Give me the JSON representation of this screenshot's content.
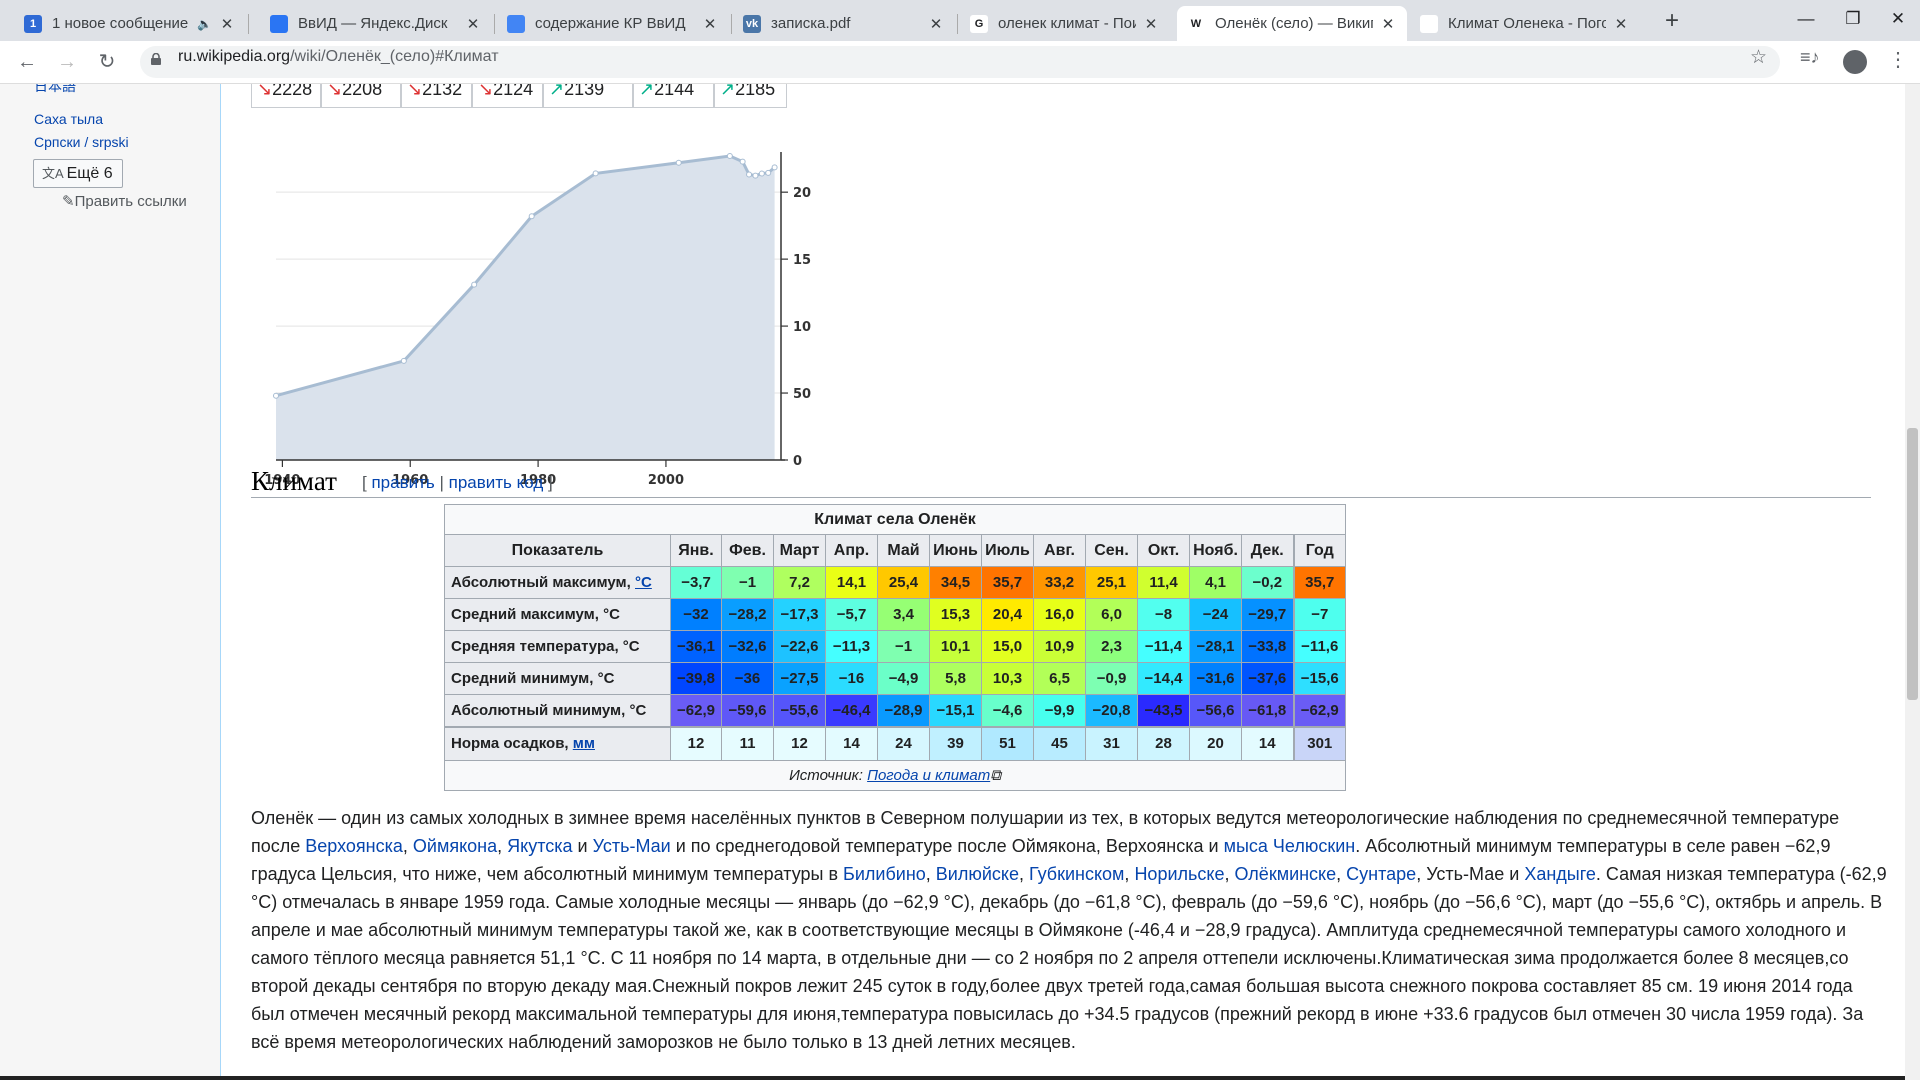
{
  "browser": {
    "tabs": [
      {
        "title": "1 новое сообщение",
        "favicon": "1",
        "fav_color": "#2f6ad5",
        "extra": "audio-icon"
      },
      {
        "title": "ВвИД — Яндекс.Диск",
        "favicon": "",
        "fav_color": "#2a75f3"
      },
      {
        "title": "содержание КР ВвИД",
        "favicon": "",
        "fav_color": "#4285f4"
      },
      {
        "title": "записка.pdf",
        "favicon": "vk",
        "fav_color": "#4a76a8"
      },
      {
        "title": "оленек климат - Поиск",
        "favicon": "G",
        "fav_color": "#ffffff"
      },
      {
        "title": "Оленёк (село) — Википедия",
        "favicon": "W",
        "fav_color": "#ffffff"
      },
      {
        "title": "Климат Оленека - Погода",
        "favicon": "",
        "fav_color": "#ffffff"
      }
    ],
    "new_tab": "+",
    "window_controls": {
      "minimize": "—",
      "maximize": "❐",
      "close": "✕"
    },
    "url_host": "ru.wikipedia.org",
    "url_path": "/wiki/Оленёк_(село)#Климат"
  },
  "sidebar": {
    "langs": [
      "日本語",
      "Саха тыла",
      "Српски / srpski"
    ],
    "more": "Ещё 6",
    "edit_links": "Править ссылки"
  },
  "population": {
    "cells": [
      {
        "arrow": "↘",
        "value": "2228",
        "dir": "down"
      },
      {
        "arrow": "↘",
        "value": "2208",
        "dir": "down"
      },
      {
        "arrow": "↘",
        "value": "2132",
        "dir": "down"
      },
      {
        "arrow": "↘",
        "value": "2124",
        "dir": "down"
      },
      {
        "arrow": "↗",
        "value": "2139",
        "dir": "up"
      },
      {
        "arrow": "↗",
        "value": "2144",
        "dir": "up"
      },
      {
        "arrow": "↗",
        "value": "2185",
        "dir": "up"
      }
    ]
  },
  "chart_data": {
    "type": "area",
    "title": "",
    "xlabel": "",
    "ylabel": "",
    "x": [
      1939,
      1959,
      1970,
      1979,
      1989,
      2002,
      2010,
      2012,
      2013,
      2014,
      2015,
      2016,
      2017
    ],
    "values": [
      480,
      740,
      1310,
      1820,
      2140,
      2220,
      2270,
      2228,
      2132,
      2124,
      2139,
      2144,
      2185
    ],
    "xticks": [
      "1940",
      "1960",
      "1980",
      "2000"
    ],
    "yticks": [
      "0",
      "500",
      "1000",
      "1500",
      "2000"
    ],
    "xlim": [
      1939,
      2018
    ],
    "ylim": [
      0,
      2300
    ],
    "grid": true,
    "colors": {
      "line": "#a7bcd2",
      "fill": "#dae2ec",
      "point": "#ffffff"
    }
  },
  "climate": {
    "heading": "Климат",
    "edit": "править",
    "edit_code": "править код",
    "caption": "Климат села Оленёк",
    "head_label": "Показатель",
    "months": [
      "Янв.",
      "Фев.",
      "Март",
      "Апр.",
      "Май",
      "Июнь",
      "Июль",
      "Авг.",
      "Сен.",
      "Окт.",
      "Нояб.",
      "Дек."
    ],
    "year": "Год",
    "rows": [
      {
        "label": "Абсолютный максимум, ",
        "unit": "°C",
        "unit_link": true,
        "values": [
          "−3,7",
          "−1",
          "7,2",
          "14,1",
          "25,4",
          "34,5",
          "35,7",
          "33,2",
          "25,1",
          "11,4",
          "4,1",
          "−0,2"
        ],
        "year": "35,7",
        "colors": [
          "#65ffd6",
          "#7fffb0",
          "#afff5f",
          "#eaff15",
          "#ffc800",
          "#ff8000",
          "#ff7400",
          "#ff9600",
          "#ffc800",
          "#d0ff2f",
          "#9fff66",
          "#6cffcd"
        ],
        "year_color": "#ff7400"
      },
      {
        "label": "Средний максимум, °C",
        "unit": "",
        "unit_link": false,
        "values": [
          "−32",
          "−28,2",
          "−17,3",
          "−5,7",
          "3,4",
          "15,3",
          "20,4",
          "16,0",
          "6,0",
          "−8",
          "−24",
          "−29,7"
        ],
        "year": "−7",
        "colors": [
          "#0080ff",
          "#0a9eff",
          "#24d2ff",
          "#5dffe0",
          "#96ff74",
          "#e0ff20",
          "#ffea00",
          "#e7ff18",
          "#b2ff58",
          "#52ffef",
          "#16c0ff",
          "#0691ff"
        ],
        "year_color": "#4effee"
      },
      {
        "label": "Средняя температура, °C",
        "unit": "",
        "unit_link": false,
        "values": [
          "−36,1",
          "−32,6",
          "−22,6",
          "−11,3",
          "−1",
          "10,1",
          "15,0",
          "10,9",
          "2,3",
          "−11,4",
          "−28,1",
          "−33,8"
        ],
        "year": "−11,6",
        "colors": [
          "#0062ff",
          "#007dff",
          "#1ec2ff",
          "#45ffff",
          "#7fffb0",
          "#c6ff3a",
          "#e2ff1f",
          "#caff36",
          "#8dff7d",
          "#45ffff",
          "#0a9eff",
          "#0072ff"
        ],
        "year_color": "#45ffff"
      },
      {
        "label": "Средний минимум, °C",
        "unit": "",
        "unit_link": false,
        "values": [
          "−39,8",
          "−36",
          "−27,5",
          "−16",
          "−4,9",
          "5,8",
          "10,3",
          "6,5",
          "−0,9",
          "−14,4",
          "−31,6",
          "−37,6"
        ],
        "year": "−15,6",
        "colors": [
          "#0046ff",
          "#0062ff",
          "#0aa2ff",
          "#2bdcff",
          "#6bffc8",
          "#adff5f",
          "#c8ff38",
          "#b2ff58",
          "#7dffb2",
          "#32eaff",
          "#0081ff",
          "#0055ff"
        ],
        "year_color": "#2edfff"
      },
      {
        "label": "Абсолютный минимум, °C",
        "unit": "",
        "unit_link": false,
        "values": [
          "−62,9",
          "−59,6",
          "−55,6",
          "−46,4",
          "−28,9",
          "−15,1",
          "−4,6",
          "−9,9",
          "−20,8",
          "−43,5",
          "−56,6",
          "−61,8"
        ],
        "year": "−62,9",
        "colors": [
          "#6a5cf5",
          "#5f58f7",
          "#5555fa",
          "#3a3aff",
          "#0a9aff",
          "#29d8ff",
          "#68ffcb",
          "#48ffee",
          "#1bbaff",
          "#2a2aff",
          "#5757f9",
          "#6759f5"
        ],
        "year_color": "#6a5cf5"
      },
      {
        "label": "Норма осадков, ",
        "unit": "мм",
        "unit_link": true,
        "values": [
          "12",
          "11",
          "12",
          "14",
          "24",
          "39",
          "51",
          "45",
          "31",
          "28",
          "20",
          "14"
        ],
        "year": "301",
        "colors": [
          "#e6fcff",
          "#e6fcff",
          "#e6fcff",
          "#e3fbff",
          "#d6f7ff",
          "#c0f0ff",
          "#b0e9ff",
          "#b8ecff",
          "#c9f3ff",
          "#cef5ff",
          "#dcf9ff",
          "#e3fbff"
        ],
        "year_color": "#c9d5f8"
      }
    ],
    "source_label": "Источник: ",
    "source_link": "Погода и климат"
  },
  "paragraph": [
    {
      "t": "Оленёк — один из самых холодных в зимнее время населённых пунктов в Северном полушарии из тех, в которых ведутся метеорологические наблюдения по среднемесячной температуре после "
    },
    {
      "t": "Верхоянска",
      "l": 1
    },
    {
      "t": ", "
    },
    {
      "t": "Оймякона",
      "l": 1
    },
    {
      "t": ", "
    },
    {
      "t": "Якутска",
      "l": 1
    },
    {
      "t": " и "
    },
    {
      "t": "Усть-Маи",
      "l": 1
    },
    {
      "t": " и по среднегодовой температуре после Оймякона, Верхоянска и "
    },
    {
      "t": "мыса Челюскин",
      "l": 1
    },
    {
      "t": ". Абсолютный минимум температуры в селе равен −62,9 градуса Цельсия, что ниже, чем абсолютный минимум температуры в "
    },
    {
      "t": "Билибино",
      "l": 1
    },
    {
      "t": ", "
    },
    {
      "t": "Вилюйске",
      "l": 1
    },
    {
      "t": ", "
    },
    {
      "t": "Губкинском",
      "l": 1
    },
    {
      "t": ", "
    },
    {
      "t": "Норильске",
      "l": 1
    },
    {
      "t": ", "
    },
    {
      "t": "Олёкминске",
      "l": 1
    },
    {
      "t": ", "
    },
    {
      "t": "Сунтаре",
      "l": 1
    },
    {
      "t": ", Усть-Мае и "
    },
    {
      "t": "Хандыге",
      "l": 1
    },
    {
      "t": ". Самая низкая температура (-62,9 °C) отмечалась в январе 1959 года. Самые холодные месяцы — январь (до −62,9 °C), декабрь (до −61,8 °C), февраль (до −59,6 °C), ноябрь (до −56,6 °C), март (до −55,6 °C), октябрь и апрель. В апреле и мае абсолютный минимум температуры такой же, как в соответствующие месяцы в Оймяконе (-46,4 и −28,9 градуса). Амплитуда среднемесячной температуры самого холодного и самого тёплого месяца равняется 51,1 °C. С 11 ноября по 14 марта, в отдельные дни — со 2 ноября по 2 апреля оттепели исключены.Климатическая зима продолжается более 8 месяцев,со второй декады сентября по вторую декаду мая.Снежный покров лежит 245 суток в году,более двух третей года,самая большая высота снежного покрова составляет 85 см. 19 июня 2014 года был отмечен месячный рекорд максимальной температуры для июня,температура повысилась до +34.5 градусов (прежний рекорд в июне +33.6 градусов был отмечен 30 числа 1959 года). За всё время метеорологических наблюдений заморозков не было только в 13 дней летних месяцев."
    }
  ]
}
